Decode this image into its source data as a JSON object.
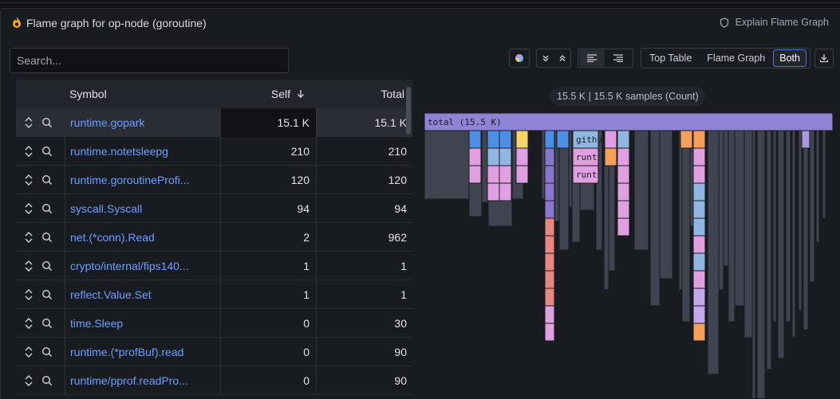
{
  "title": "Flame graph for op-node (goroutine)",
  "explain_label": "Explain Flame Graph",
  "search": {
    "placeholder": "Search..."
  },
  "view_options": [
    "Top Table",
    "Flame Graph",
    "Both"
  ],
  "view_selected": "Both",
  "table": {
    "headers": {
      "symbol": "Symbol",
      "self": "Self",
      "total": "Total"
    },
    "sort_column": "Self",
    "rows": [
      {
        "symbol": "runtime.gopark",
        "self": "15.1 K",
        "total": "15.1 K"
      },
      {
        "symbol": "runtime.notetsleepg",
        "self": "210",
        "total": "210"
      },
      {
        "symbol": "runtime.goroutineProfi...",
        "self": "120",
        "total": "120"
      },
      {
        "symbol": "syscall.Syscall",
        "self": "94",
        "total": "94"
      },
      {
        "symbol": "net.(*conn).Read",
        "self": "2",
        "total": "962"
      },
      {
        "symbol": "crypto/internal/fips140...",
        "self": "1",
        "total": "1"
      },
      {
        "symbol": "reflect.Value.Set",
        "self": "1",
        "total": "1"
      },
      {
        "symbol": "time.Sleep",
        "self": "0",
        "total": "30"
      },
      {
        "symbol": "runtime.(*profBuf).read",
        "self": "0",
        "total": "90"
      },
      {
        "symbol": "runtime/pprof.readPro...",
        "self": "0",
        "total": "90"
      }
    ]
  },
  "samples_label": "15.5 K | 15.5 K samples (Count)",
  "flamegraph": {
    "root_label": "total (15.5 K)",
    "labels": [
      "githu",
      "runt",
      "runt"
    ]
  },
  "colors": {
    "accent": "#6e9fff",
    "root": "#8f83d6",
    "gray_frame": "#404350"
  }
}
